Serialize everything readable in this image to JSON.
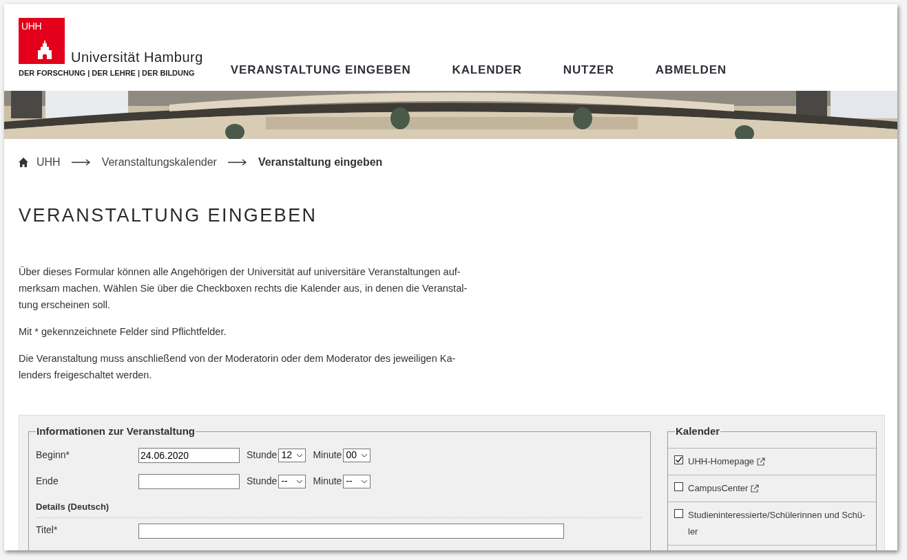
{
  "logo": {
    "mark": "UHH",
    "name": "Universität Hamburg",
    "tagline": "DER FORSCHUNG | DER LEHRE | DER BILDUNG"
  },
  "nav": [
    {
      "label": "VERANSTALTUNG EINGEBEN"
    },
    {
      "label": "KALENDER"
    },
    {
      "label": "NUTZER"
    },
    {
      "label": "ABMELDEN"
    }
  ],
  "banner": {
    "kind": "picture"
  },
  "breadcrumb": [
    {
      "label": "UHH",
      "current": false
    },
    {
      "label": "Veranstaltungskalender",
      "current": false
    },
    {
      "label": "Veranstaltung eingeben",
      "current": true
    }
  ],
  "heading": "VERANSTALTUNG EINGEBEN",
  "intro": [
    "Über dieses Formular können alle Angehörigen der Universität auf universitäre Veranstaltungen auf-\nmerksam machen. Wählen Sie über die Checkboxen rechts die Kalender aus, in denen die Veranstal-\ntung erscheinen soll.",
    "Mit * gekennzeichnete Felder sind Pflichtfelder.",
    "Die Veranstaltung muss anschließend von der Moderatorin oder dem Moderator des jeweiligen Ka-\nlenders freigeschaltet werden."
  ],
  "event_form": {
    "legend": "Informationen zur Veranstaltung",
    "rows": [
      {
        "label": "Beginn*",
        "date": "24.06.2020",
        "hour_label": "Stunde",
        "hour": "12",
        "minute_label": "Minute",
        "minute": "00"
      },
      {
        "label": "Ende",
        "hour_label": "Stunde",
        "hour": "--",
        "minute_label": "Minute",
        "minute": "--"
      }
    ],
    "section": "Details (Deutsch)",
    "title_label": "Titel*"
  },
  "calendars": {
    "legend": "Kalender",
    "items": [
      {
        "label": "UHH-Homepage",
        "checked": true,
        "external": true
      },
      {
        "label": "CampusCenter",
        "checked": false,
        "external": true
      },
      {
        "label": "Studieninteressierte/Schülerinnen und Schü-\nler",
        "checked": false,
        "external": false
      }
    ]
  }
}
